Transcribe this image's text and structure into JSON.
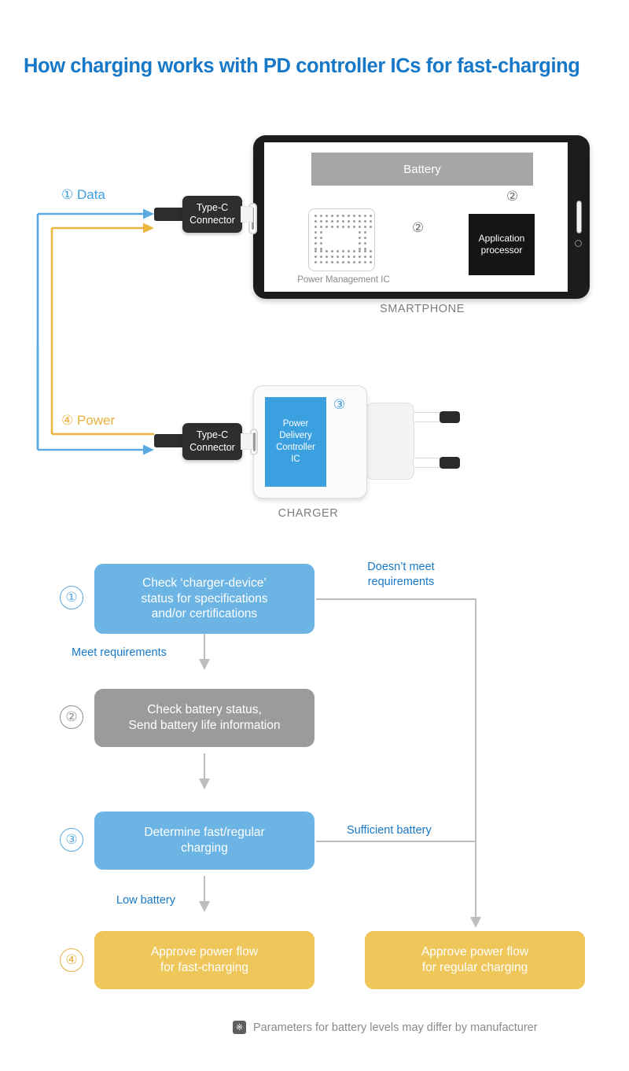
{
  "title": "How charging works with PD controller ICs for fast-charging",
  "diagram": {
    "data_flow_label": "① Data",
    "power_flow_label": "④ Power",
    "smartphone": {
      "caption": "SMARTPHONE",
      "battery_label": "Battery",
      "pmic_label": "Power Management IC",
      "ap_line1": "Application",
      "ap_line2": "processor",
      "marker_ap_link": "②",
      "marker_battery_link": "②"
    },
    "charger": {
      "caption": "CHARGER",
      "pd_ic_line1": "Power",
      "pd_ic_line2": "Delivery",
      "pd_ic_line3": "Controller",
      "pd_ic_line4": "IC",
      "marker": "③"
    },
    "connector_top": {
      "line1": "Type-C",
      "line2": "Connector"
    },
    "connector_bottom": {
      "line1": "Type-C",
      "line2": "Connector"
    }
  },
  "flow": {
    "steps": [
      {
        "number": "①",
        "text_line1": "Check ‘charger-device’",
        "text_line2": "status for specifications",
        "text_line3": "and/or certifications",
        "color": "blue"
      },
      {
        "number": "②",
        "text_line1": "Check battery status,",
        "text_line2": "Send battery life information",
        "color": "gray"
      },
      {
        "number": "③",
        "text_line1": "Determine fast/regular",
        "text_line2": "charging",
        "color": "blue"
      },
      {
        "number": "④",
        "text_line1": "Approve power flow",
        "text_line2": "for fast-charging",
        "color": "amber"
      }
    ],
    "regular_box": {
      "text_line1": "Approve power flow",
      "text_line2": "for regular charging",
      "color": "amber"
    },
    "edge_labels": {
      "meet_requirements": "Meet requirements",
      "doesnt_meet_line1": "Doesn’t meet",
      "doesnt_meet_line2": "requirements",
      "low_battery": "Low battery",
      "sufficient_battery": "Sufficient battery"
    }
  },
  "footnote": {
    "mark": "※",
    "text": "Parameters for battery levels may differ by manufacturer"
  },
  "colors": {
    "title_blue": "#1878c8",
    "box_blue": "#6cb4e4",
    "box_gray": "#9b9b9b",
    "box_amber": "#eec65a",
    "pd_ic_blue": "#3aa0e0",
    "data_arrow_blue": "#3c9de0",
    "power_arrow_amber": "#e9b13c",
    "line_gray": "#bdbdbd"
  }
}
